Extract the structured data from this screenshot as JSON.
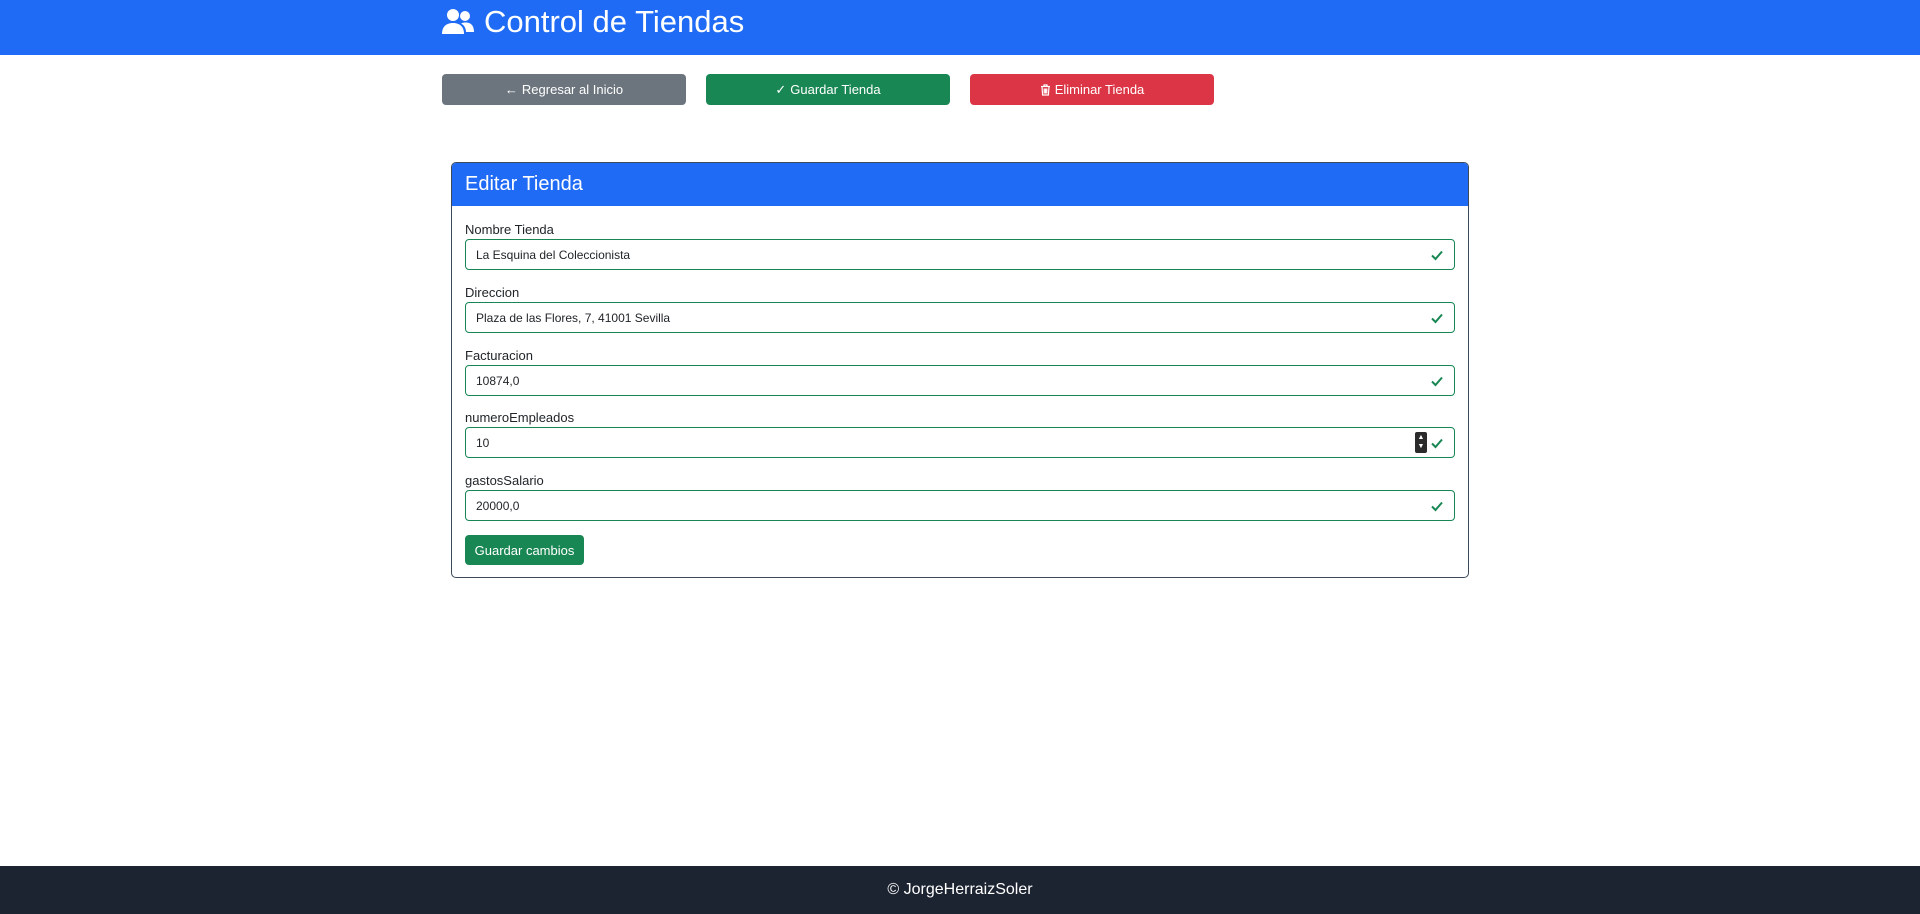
{
  "header": {
    "title": "Control de Tiendas",
    "icon": "users-icon"
  },
  "actions": {
    "back_label": "Regresar al Inicio",
    "back_icon": "←",
    "save_label": "Guardar Tienda",
    "save_icon": "✓",
    "delete_label": "Eliminar Tienda",
    "delete_icon": "🗑"
  },
  "form": {
    "title": "Editar Tienda",
    "fields": [
      {
        "label": "Nombre Tienda",
        "value": "La Esquina del Coleccionista"
      },
      {
        "label": "Direccion",
        "value": "Plaza de las Flores, 7, 41001 Sevilla"
      },
      {
        "label": "Facturacion",
        "value": "10874,0"
      },
      {
        "label": "numeroEmpleados",
        "value": "10"
      },
      {
        "label": "gastosSalario",
        "value": "20000,0"
      }
    ],
    "submit_label": "Guardar cambios"
  },
  "footer": {
    "text": "© JorgeHerraizSoler"
  },
  "colors": {
    "primary": "#1f6bf5",
    "success": "#198754",
    "danger": "#dc3545",
    "secondary": "#6c757d",
    "footer_bg": "#1c2331"
  }
}
